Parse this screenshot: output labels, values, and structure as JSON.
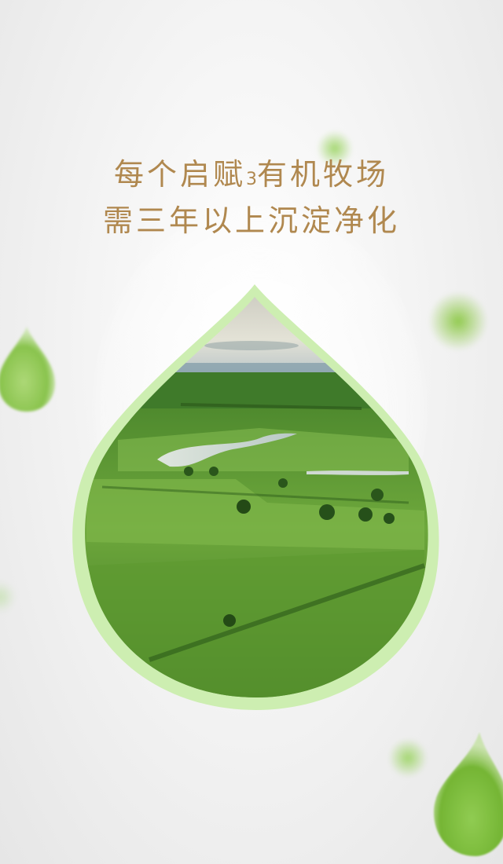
{
  "headline": {
    "line1_prefix": "每个启赋",
    "line1_sub": "3",
    "line1_suffix": "有机牧场",
    "line2": "需三年以上沉淀净化"
  },
  "colors": {
    "headline_text": "#b0884f",
    "drop_border": "#cdeeb1",
    "background": "#f2f2f2",
    "accent_green": "#8cc63f"
  },
  "image": {
    "subject": "aerial view of green pasture farmland with a winding river"
  }
}
